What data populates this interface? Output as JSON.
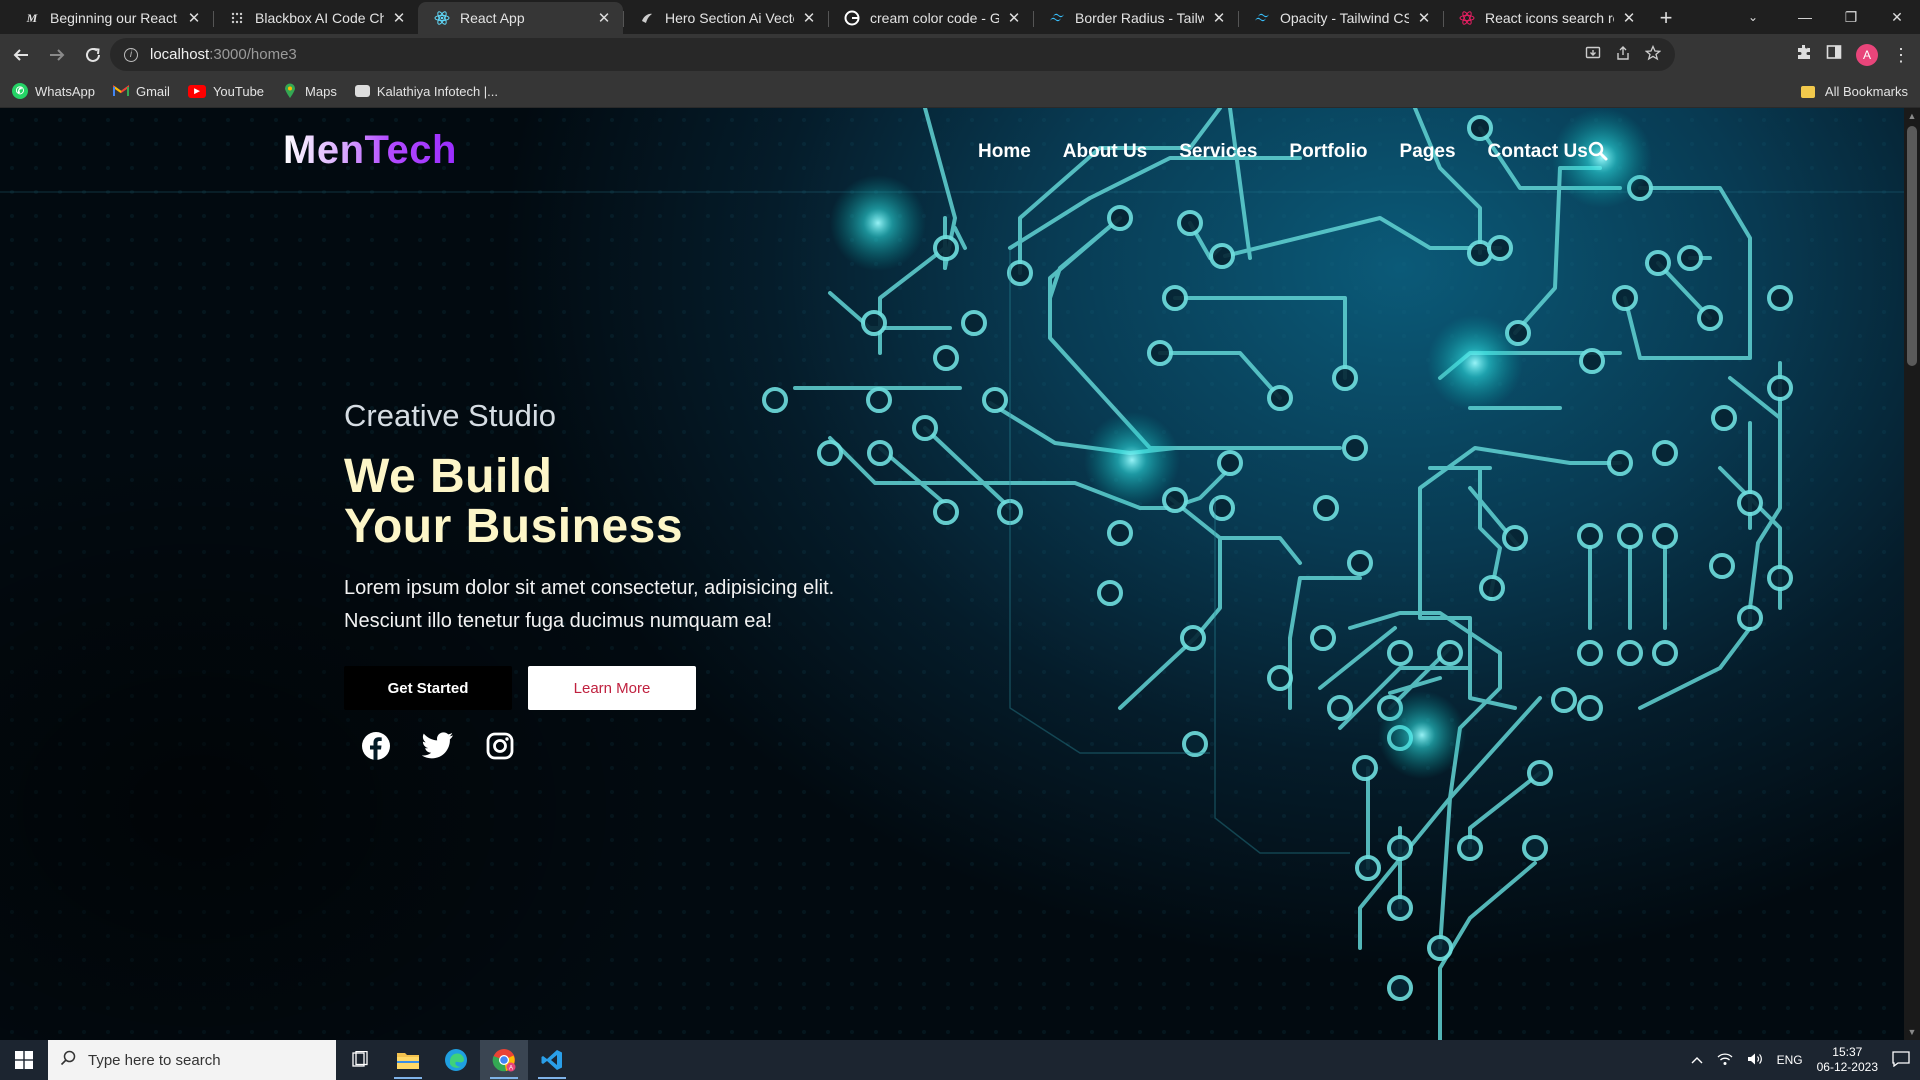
{
  "browser": {
    "tabs": [
      {
        "title": "Beginning our React todo",
        "favicon": "M"
      },
      {
        "title": "Blackbox AI Code Chat",
        "favicon": "blackbox-icon"
      },
      {
        "title": "React App",
        "favicon": "react-icon",
        "active": true
      },
      {
        "title": "Hero Section Ai Vectors, P",
        "favicon": "freepik-icon"
      },
      {
        "title": "cream color code - Googl",
        "favicon": "google-icon"
      },
      {
        "title": "Border Radius - Tailwind C",
        "favicon": "tailwind-icon"
      },
      {
        "title": "Opacity - Tailwind CSS",
        "favicon": "tailwind-icon"
      },
      {
        "title": "React icons search results",
        "favicon": "react-icons-icon"
      }
    ],
    "url_host": "localhost",
    "url_path": ":3000/home3",
    "bookmarks": [
      {
        "label": "WhatsApp",
        "icon": "whatsapp-icon"
      },
      {
        "label": "Gmail",
        "icon": "gmail-icon"
      },
      {
        "label": "YouTube",
        "icon": "youtube-icon"
      },
      {
        "label": "Maps",
        "icon": "maps-icon"
      },
      {
        "label": "Kalathiya Infotech |...",
        "icon": "bookmark-icon"
      }
    ],
    "all_bookmarks": "All Bookmarks",
    "profile_initial": "A"
  },
  "site": {
    "logo": "MenTech",
    "nav": [
      "Home",
      "About Us",
      "Services",
      "Portfolio",
      "Pages",
      "Contact Us"
    ],
    "hero": {
      "kicker": "Creative Studio",
      "title_line1": "We Build",
      "title_line2": "Your Business",
      "lead": "Lorem ipsum dolor sit amet consectetur, adipisicing elit. Nesciunt illo tenetur fuga ducimus numquam ea!",
      "primary_button": "Get Started",
      "secondary_button": "Learn More"
    },
    "socials": [
      "facebook-icon",
      "twitter-icon",
      "instagram-icon"
    ],
    "colors": {
      "title": "#fdf6c8",
      "accent": "#c0213f",
      "circuit": "#5fd3d6"
    }
  },
  "taskbar": {
    "search_placeholder": "Type here to search",
    "language": "ENG",
    "time": "15:37",
    "date": "06-12-2023"
  }
}
